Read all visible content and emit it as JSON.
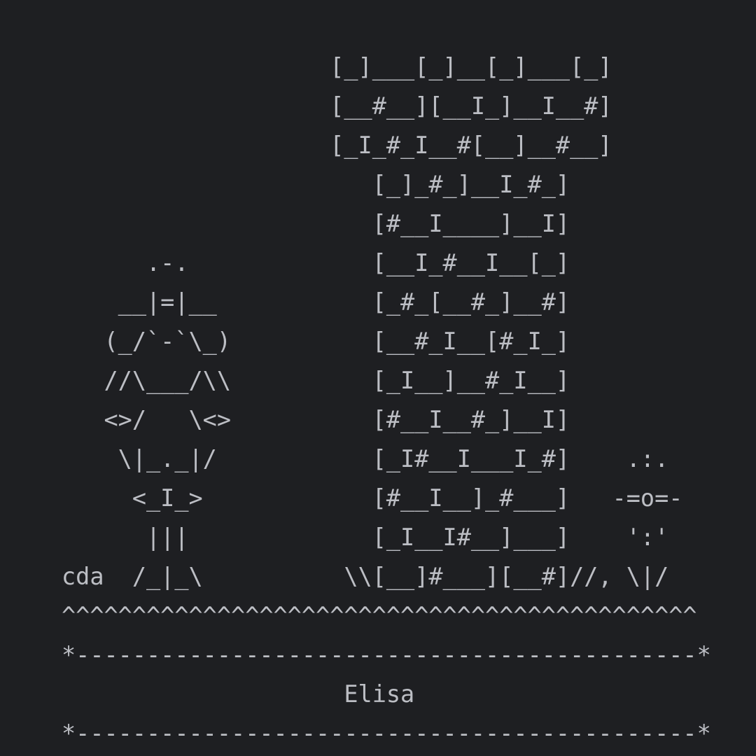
{
  "terminal": {
    "art_lines": [
      "                   [_]___[_]__[_]___[_]",
      "                   [__#__][__I_]__I__#]",
      "                   [_I_#_I__#[__]__#__]",
      "                      [_]_#_]__I_#_]",
      "                      [#__I____]__I]",
      "      .-.             [__I_#__I__[_]",
      "    __|=|__           [_#_[__#_]__#]",
      "   (_/`-`\\_)          [__#_I__[#_I_]",
      "   //\\___/\\\\          [_I__]__#_I__]",
      "   <>/   \\<>          [#__I__#_]__I]",
      "    \\|_._|/           [_I#__I___I_#]    .:.",
      "     <_I_>            [#__I__]_#___]   -=o=-",
      "      |||             [_I__I#__]___]    ':'",
      "cda  /_|_\\          \\\\[__]#___][__#]//, \\|/",
      "^^^^^^^^^^^^^^^^^^^^^^^^^^^^^^^^^^^^^^^^^^^^^"
    ],
    "divider_top": "*--------------------------------------------*",
    "name_line": "                    Elisa",
    "divider_bottom": "*--------------------------------------------*"
  }
}
